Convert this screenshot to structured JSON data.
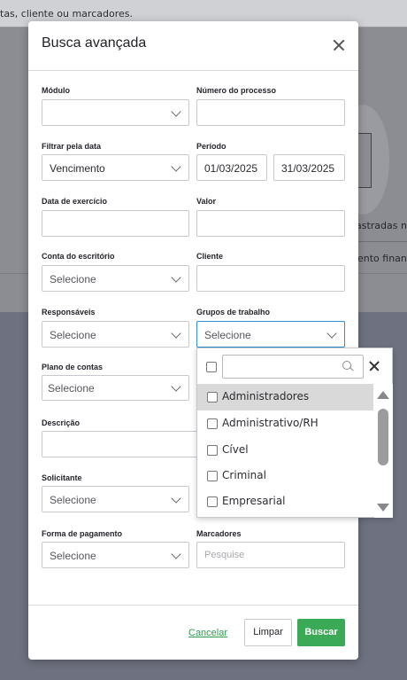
{
  "background": {
    "search_hint": "tas, cliente ou marcadores.",
    "text_right_1": "astradas no",
    "text_right_2": "ento financ"
  },
  "modal": {
    "title": "Busca avançada",
    "fields": {
      "modulo": {
        "label": "Módulo",
        "value": ""
      },
      "numero_processo": {
        "label": "Número do processo",
        "value": ""
      },
      "filtrar_data": {
        "label": "Filtrar pela data",
        "value": "Vencimento"
      },
      "periodo": {
        "label": "Período",
        "start": "01/03/2025",
        "end": "31/03/2025"
      },
      "data_exercicio": {
        "label": "Data de exercício",
        "value": ""
      },
      "valor": {
        "label": "Valor",
        "value": ""
      },
      "conta_escritorio": {
        "label": "Conta do escritório",
        "value": "Selecione"
      },
      "cliente": {
        "label": "Cliente",
        "value": ""
      },
      "responsaveis": {
        "label": "Responsáveis",
        "value": "Selecione"
      },
      "grupos_trabalho": {
        "label": "Grupos de trabalho",
        "value": "Selecione"
      },
      "plano_contas": {
        "label": "Plano de contas",
        "value": "Selecione"
      },
      "descricao": {
        "label": "Descrição",
        "value": ""
      },
      "solicitante": {
        "label": "Solicitante",
        "value": "Selecione"
      },
      "forma_pagamento": {
        "label": "Forma de pagamento",
        "value": "Selecione"
      },
      "marcadores": {
        "label": "Marcadores",
        "placeholder": "Pesquise"
      }
    },
    "footer": {
      "cancel": "Cancelar",
      "clear": "Limpar",
      "search": "Buscar"
    }
  },
  "dropdown": {
    "search_value": "",
    "items": [
      "Administradores",
      "Administrativo/RH",
      "Cível",
      "Criminal",
      "Empresarial"
    ],
    "highlighted_index": 0
  },
  "colors": {
    "accent_green": "#3aaa57",
    "focus_blue": "#2f8fd6"
  }
}
